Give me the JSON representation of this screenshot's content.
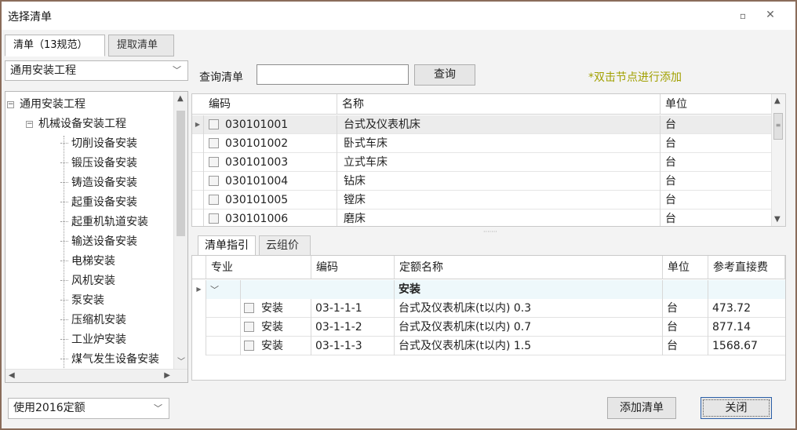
{
  "window": {
    "title": "选择清单",
    "restore_glyph": "▫",
    "close_glyph": "✕"
  },
  "top_tabs": [
    {
      "label": "清单（13规范）",
      "active": true
    },
    {
      "label": "提取清单",
      "active": false
    }
  ],
  "left": {
    "spec_select": "通用安装工程",
    "tree": [
      {
        "label": "通用安装工程",
        "level": 0,
        "expander": "−"
      },
      {
        "label": "机械设备安装工程",
        "level": 1,
        "expander": "−"
      },
      {
        "label": "切削设备安装",
        "level": 2
      },
      {
        "label": "锻压设备安装",
        "level": 2
      },
      {
        "label": "铸造设备安装",
        "level": 2
      },
      {
        "label": "起重设备安装",
        "level": 2
      },
      {
        "label": "起重机轨道安装",
        "level": 2
      },
      {
        "label": "输送设备安装",
        "level": 2
      },
      {
        "label": "电梯安装",
        "level": 2
      },
      {
        "label": "风机安装",
        "level": 2
      },
      {
        "label": "泵安装",
        "level": 2
      },
      {
        "label": "压缩机安装",
        "level": 2
      },
      {
        "label": "工业炉安装",
        "level": 2
      },
      {
        "label": "煤气发生设备安装",
        "level": 2
      }
    ]
  },
  "search": {
    "label": "查询清单",
    "value": "",
    "button": "查询",
    "hint": "*双击节点进行添加"
  },
  "list_grid": {
    "headers": {
      "code": "编码",
      "name": "名称",
      "unit": "单位"
    },
    "rows": [
      {
        "code": "030101001",
        "name": "台式及仪表机床",
        "unit": "台",
        "selected": true
      },
      {
        "code": "030101002",
        "name": "卧式车床",
        "unit": "台"
      },
      {
        "code": "030101003",
        "name": "立式车床",
        "unit": "台"
      },
      {
        "code": "030101004",
        "name": "钻床",
        "unit": "台"
      },
      {
        "code": "030101005",
        "name": "镗床",
        "unit": "台"
      },
      {
        "code": "030101006",
        "name": "磨床",
        "unit": "台"
      }
    ]
  },
  "sub_tabs": [
    {
      "label": "清单指引",
      "active": true
    },
    {
      "label": "云组价",
      "active": false
    }
  ],
  "quota_grid": {
    "headers": {
      "major": "专业",
      "code": "编码",
      "name": "定额名称",
      "unit": "单位",
      "price": "参考直接费"
    },
    "group": "安装",
    "rows": [
      {
        "major": "安装",
        "code": "03-1-1-1",
        "name": "台式及仪表机床(t以内) 0.3",
        "unit": "台",
        "price": "473.72"
      },
      {
        "major": "安装",
        "code": "03-1-1-2",
        "name": "台式及仪表机床(t以内) 0.7",
        "unit": "台",
        "price": "877.14"
      },
      {
        "major": "安装",
        "code": "03-1-1-3",
        "name": "台式及仪表机床(t以内) 1.5",
        "unit": "台",
        "price": "1568.67"
      }
    ]
  },
  "footer": {
    "quota_select": "使用2016定额",
    "add_button": "添加清单",
    "close_button": "关闭"
  }
}
